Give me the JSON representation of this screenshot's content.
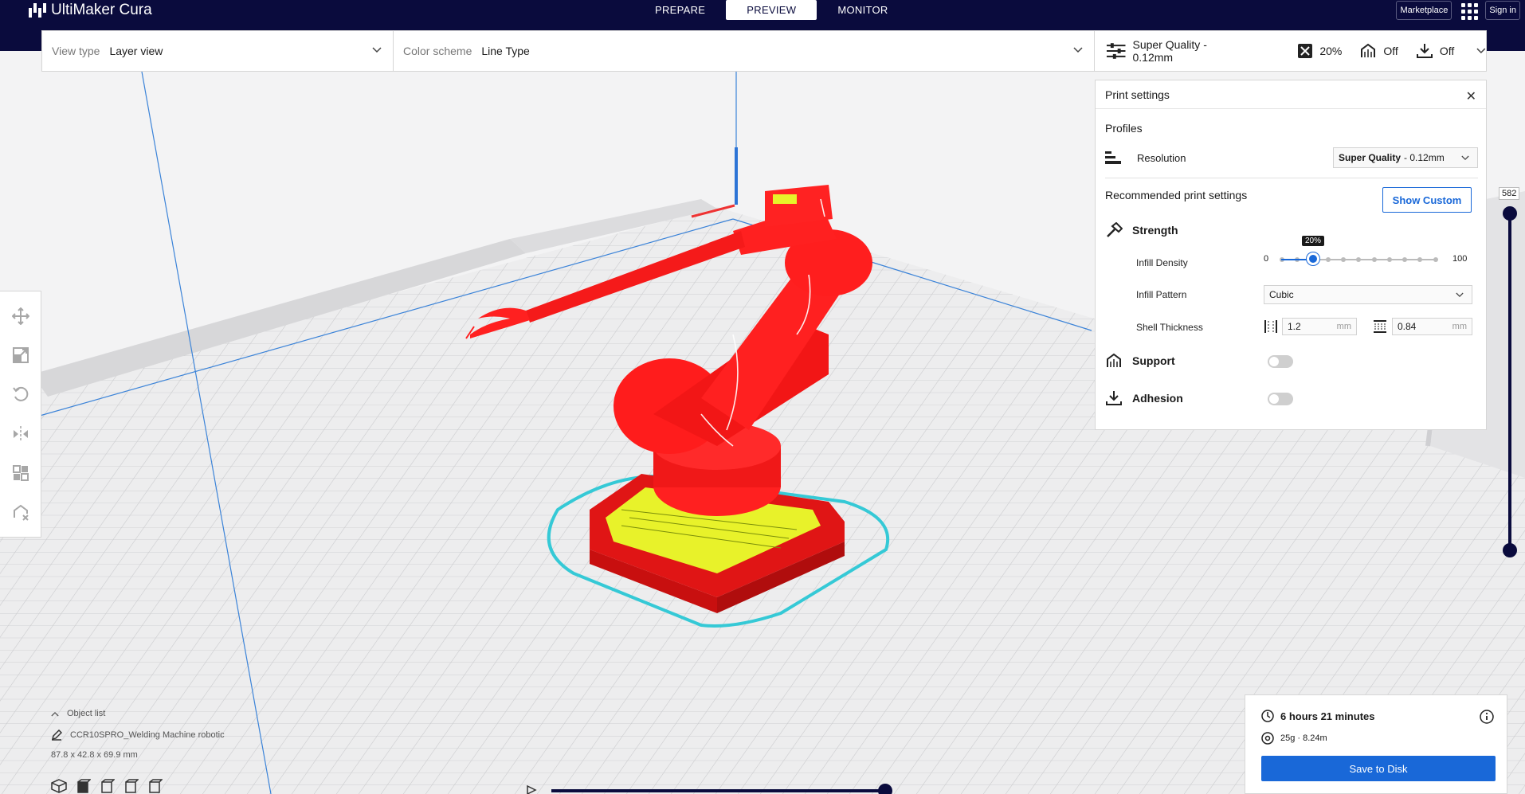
{
  "app": {
    "title": "UltiMaker Cura"
  },
  "stages": [
    {
      "label": "PREPARE"
    },
    {
      "label": "PREVIEW"
    },
    {
      "label": "MONITOR"
    }
  ],
  "header_right": {
    "marketplace": "Marketplace",
    "signin": "Sign in"
  },
  "viewbar": {
    "view_type_label": "View type",
    "view_type_value": "Layer view",
    "color_scheme_label": "Color scheme",
    "color_scheme_value": "Line Type"
  },
  "quality_bar": {
    "profile": "Super Quality - 0.12mm",
    "infill": "20%",
    "support": "Off",
    "adhesion": "Off"
  },
  "print_settings": {
    "title": "Print settings",
    "profiles_title": "Profiles",
    "resolution_label": "Resolution",
    "resolution_value_bold": "Super Quality",
    "resolution_value_rest": "- 0.12mm",
    "recommended_title": "Recommended print settings",
    "show_custom": "Show Custom",
    "strength": "Strength",
    "infill_density_label": "Infill Density",
    "infill_min": "0",
    "infill_max": "100",
    "infill_value": "20%",
    "infill_fraction": 0.2,
    "infill_pattern_label": "Infill Pattern",
    "infill_pattern_value": "Cubic",
    "shell_thickness_label": "Shell Thickness",
    "wall_thickness": "1.2",
    "top_bottom_thickness": "0.84",
    "unit": "mm",
    "support": "Support",
    "adhesion": "Adhesion"
  },
  "layer_slider": {
    "value": "582"
  },
  "object_list": {
    "title": "Object list",
    "object_name": "CCR10SPRO_Welding Machine robotic",
    "dimensions": "87.8 x 42.8 x 69.9 mm"
  },
  "summary": {
    "time": "6 hours 21 minutes",
    "material": "25g · 8.24m",
    "save": "Save to Disk"
  },
  "colors": {
    "header": "#0a0b3d",
    "accent": "#1968d8",
    "model_wall": "#ff1a1a",
    "model_infill": "#e8f22a",
    "skirt": "#35c9d6"
  }
}
